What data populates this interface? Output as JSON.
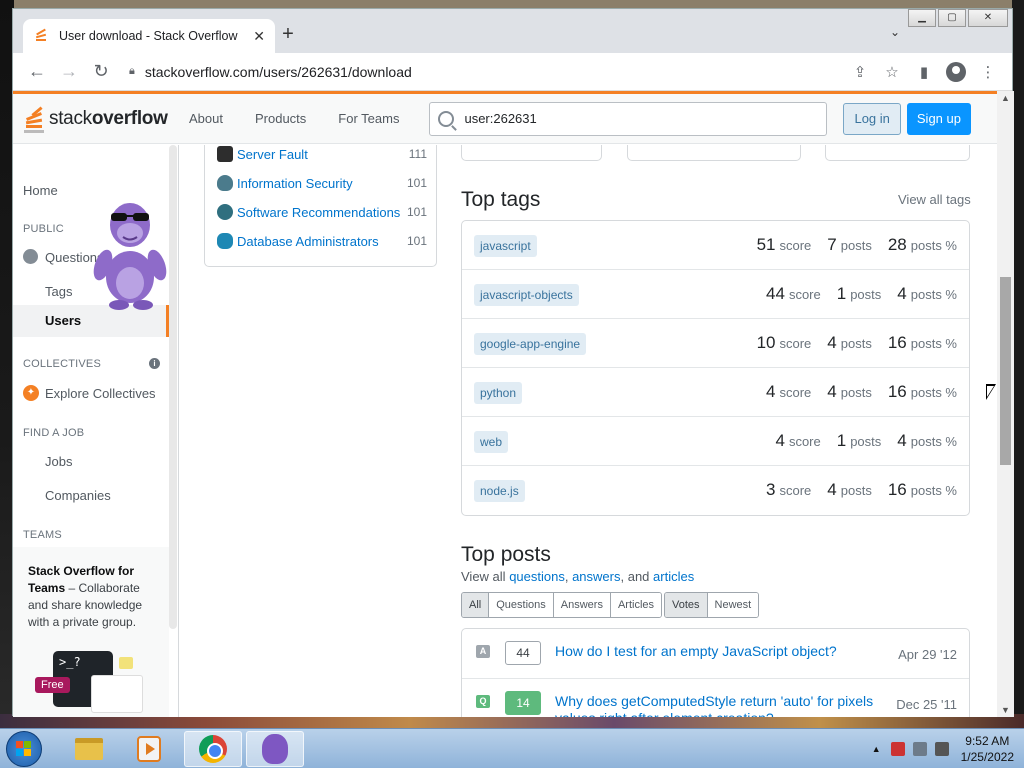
{
  "browser": {
    "tab_title": "User download - Stack Overflow",
    "tab_close": "✕",
    "new_tab": "+",
    "url": "stackoverflow.com/users/262631/download"
  },
  "so_header": {
    "logo_plain": "stack",
    "logo_bold": "overflow",
    "nav": [
      "About",
      "Products",
      "For Teams"
    ],
    "search_value": "user:262631",
    "login_label": "Log in",
    "signup_label": "Sign up"
  },
  "sidebar": {
    "home": "Home",
    "public_label": "PUBLIC",
    "questions": "Questions",
    "tags": "Tags",
    "users": "Users",
    "collectives_label": "COLLECTIVES",
    "explore_collectives": "Explore Collectives",
    "find_job_label": "FIND A JOB",
    "jobs": "Jobs",
    "companies": "Companies",
    "teams_label": "TEAMS",
    "teams_promo_bold": "Stack Overflow for Teams",
    "teams_promo_rest": " – Collaborate and share knowledge with a private group.",
    "free_badge": "Free",
    "terminal_text": ">_?"
  },
  "network_sites": [
    {
      "name": "Server Fault",
      "value": "111",
      "color": "#2d2d2d"
    },
    {
      "name": "Information Security",
      "value": "101",
      "color": "#4b7b8c"
    },
    {
      "name": "Software Recommendations",
      "value": "101",
      "color": "#2f6f7f"
    },
    {
      "name": "Database Administrators",
      "value": "101",
      "color": "#1e88b4"
    }
  ],
  "top_tags": {
    "heading": "Top tags",
    "view_all": "View all tags",
    "score_label": "score",
    "posts_label": "posts",
    "posts_pct_label": "posts %",
    "rows": [
      {
        "tag": "javascript",
        "score": "51",
        "posts": "7",
        "pct": "28"
      },
      {
        "tag": "javascript-objects",
        "score": "44",
        "posts": "1",
        "pct": "4"
      },
      {
        "tag": "google-app-engine",
        "score": "10",
        "posts": "4",
        "pct": "16"
      },
      {
        "tag": "python",
        "score": "4",
        "posts": "4",
        "pct": "16"
      },
      {
        "tag": "web",
        "score": "4",
        "posts": "1",
        "pct": "4"
      },
      {
        "tag": "node.js",
        "score": "3",
        "posts": "4",
        "pct": "16"
      }
    ]
  },
  "top_posts": {
    "heading": "Top posts",
    "view_all_prefix": "View all ",
    "link_questions": "questions",
    "sep1": ", ",
    "link_answers": "answers",
    "sep2": ", and ",
    "link_articles": "articles",
    "filters_type": [
      "All",
      "Questions",
      "Answers",
      "Articles"
    ],
    "filters_sort": [
      "Votes",
      "Newest"
    ],
    "rows": [
      {
        "type": "A",
        "votes": "44",
        "title": "How do I test for an empty JavaScript object?",
        "date": "Apr 29 '12",
        "accepted": false
      },
      {
        "type": "Q",
        "votes": "14",
        "title": "Why does getComputedStyle return 'auto' for pixels values right after element creation?",
        "date": "Dec 25 '11",
        "accepted": true
      }
    ]
  },
  "taskbar": {
    "time": "9:52 AM",
    "date": "1/25/2022"
  },
  "colors": {
    "so_orange": "#f48024",
    "link_blue": "#0074cc",
    "signup_blue": "#0a95ff",
    "accepted_green": "#5eba7d"
  }
}
